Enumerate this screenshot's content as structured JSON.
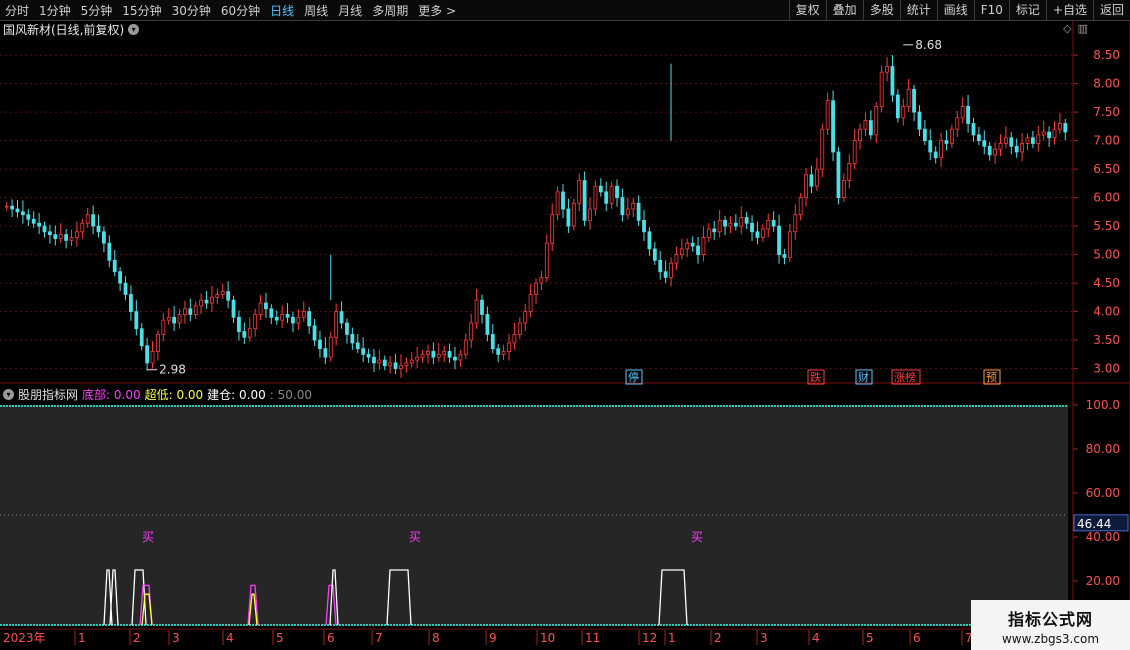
{
  "toolbar": {
    "left_items": [
      "分时",
      "1分钟",
      "5分钟",
      "15分钟",
      "30分钟",
      "60分钟",
      "日线",
      "周线",
      "月线",
      "多周期",
      "更多 >"
    ],
    "active_index": 6,
    "right_items": [
      "复权",
      "叠加",
      "多股",
      "统计",
      "画线",
      "F10",
      "标记",
      "+自选",
      "返回"
    ]
  },
  "main_panel": {
    "title": "国风新材(日线,前复权)",
    "price_ticks": [
      "8.50",
      "8.00",
      "7.50",
      "7.00",
      "6.50",
      "6.00",
      "5.50",
      "5.00",
      "4.50",
      "4.00",
      "3.50",
      "3.00"
    ],
    "high_label": "8.68",
    "low_label": "2.98",
    "markers": [
      {
        "text": "停",
        "color": "#55c8ff"
      },
      {
        "text": "跌",
        "color": "#ff4040"
      },
      {
        "text": "财",
        "color": "#55c8ff"
      },
      {
        "text": "涨榜",
        "color": "#ff4040"
      },
      {
        "text": "预",
        "color": "#ff9a3c"
      }
    ]
  },
  "indicator_panel": {
    "name": "股朋指标网",
    "legend": [
      {
        "label": "底部:",
        "value": "0.00",
        "color": "#ff3cff"
      },
      {
        "label": "超低:",
        "value": "0.00",
        "color": "#ffff3c"
      },
      {
        "label": "建仓:",
        "value": "0.00",
        "color": "#ffffff"
      },
      {
        "label": "",
        "value": ": 50.00",
        "color": "#8a8a8a"
      }
    ],
    "ticks": [
      "100.0",
      "80.00",
      "60.00",
      "40.00",
      "20.00"
    ],
    "current_value": "46.44",
    "buy_labels": [
      "买",
      "买",
      "买"
    ],
    "buy_color": "#ff3cff"
  },
  "time_axis": {
    "year_label": "2023年",
    "months": [
      "1",
      "2",
      "3",
      "4",
      "5",
      "6",
      "7",
      "8",
      "9",
      "10",
      "11",
      "12",
      "1",
      "2",
      "3",
      "4",
      "5",
      "6",
      "7"
    ]
  },
  "watermark": {
    "line1": "指标公式网",
    "line2": "www.zbgs3.com"
  },
  "chart_data": {
    "type": "candlestick",
    "title": "国风新材(日线,前复权)",
    "ylim": [
      2.8,
      8.8
    ],
    "high": 8.68,
    "low": 2.98,
    "closes": [
      5.85,
      5.8,
      5.75,
      5.7,
      5.62,
      5.55,
      5.5,
      5.4,
      5.35,
      5.28,
      5.35,
      5.25,
      5.3,
      5.4,
      5.55,
      5.7,
      5.5,
      5.4,
      5.2,
      4.9,
      4.7,
      4.5,
      4.3,
      4.0,
      3.7,
      3.4,
      3.1,
      3.3,
      3.6,
      3.85,
      3.9,
      3.8,
      3.95,
      4.05,
      3.95,
      4.1,
      4.2,
      4.15,
      4.25,
      4.3,
      4.35,
      4.2,
      3.9,
      3.65,
      3.55,
      3.7,
      3.95,
      4.15,
      4.05,
      3.9,
      3.85,
      3.95,
      3.9,
      3.8,
      3.9,
      4.0,
      3.75,
      3.5,
      3.35,
      3.2,
      3.55,
      4.0,
      3.8,
      3.6,
      3.45,
      3.35,
      3.25,
      3.2,
      3.1,
      3.15,
      3.05,
      3.1,
      3.0,
      3.05,
      3.1,
      3.15,
      3.2,
      3.25,
      3.3,
      3.2,
      3.25,
      3.3,
      3.2,
      3.15,
      3.25,
      3.5,
      3.8,
      4.2,
      3.95,
      3.6,
      3.35,
      3.25,
      3.3,
      3.45,
      3.6,
      3.8,
      4.0,
      4.3,
      4.5,
      4.6,
      5.2,
      5.7,
      6.1,
      5.8,
      5.5,
      5.9,
      6.3,
      5.6,
      5.8,
      6.2,
      6.1,
      5.9,
      6.2,
      6.0,
      5.7,
      5.8,
      5.9,
      5.6,
      5.4,
      5.1,
      4.9,
      4.7,
      4.6,
      4.85,
      5.0,
      5.1,
      5.2,
      5.15,
      5.0,
      5.3,
      5.45,
      5.4,
      5.6,
      5.5,
      5.55,
      5.5,
      5.65,
      5.55,
      5.4,
      5.3,
      5.45,
      5.6,
      5.5,
      5.0,
      4.95,
      5.4,
      5.7,
      6.0,
      6.4,
      6.2,
      6.5,
      7.2,
      7.7,
      6.8,
      6.0,
      6.3,
      6.6,
      7.0,
      7.2,
      7.35,
      7.1,
      7.6,
      8.2,
      8.3,
      7.8,
      7.4,
      7.6,
      7.9,
      7.5,
      7.2,
      7.0,
      6.8,
      6.7,
      7.0,
      6.95,
      7.2,
      7.4,
      7.6,
      7.3,
      7.1,
      7.0,
      6.9,
      6.75,
      6.85,
      6.95,
      7.05,
      6.9,
      6.8,
      6.95,
      7.05,
      6.95,
      7.1,
      7.15,
      7.05,
      7.2,
      7.3,
      7.15
    ],
    "indicator": {
      "ylim": [
        0,
        100
      ],
      "reference_line": 50,
      "current": 46.44
    }
  }
}
